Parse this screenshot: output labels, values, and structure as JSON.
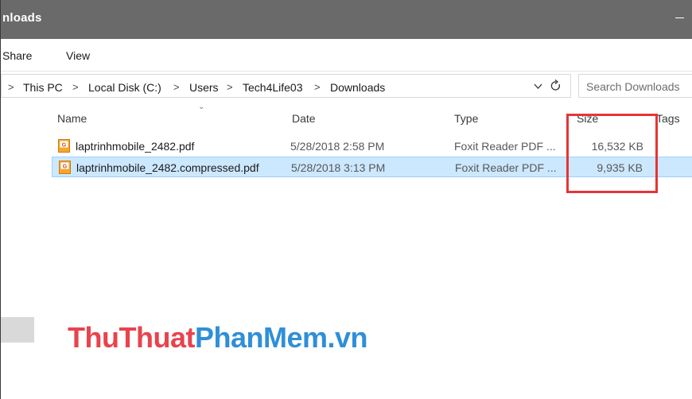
{
  "window": {
    "title": "nloads"
  },
  "ribbon": {
    "tabs": [
      "Share",
      "View"
    ]
  },
  "address": {
    "back_sep": ">",
    "crumbs": [
      "This PC",
      "Local Disk (C:)",
      "Users",
      "Tech4Life03",
      "Downloads"
    ],
    "sep": ">",
    "dropdown_icon": "chevron-down",
    "refresh_icon": "refresh"
  },
  "search": {
    "placeholder": "Search Downloads"
  },
  "columns": {
    "name": "Name",
    "date": "Date",
    "type": "Type",
    "size": "Size",
    "tags": "Tags",
    "sort_arrow": "⌄"
  },
  "files": [
    {
      "name": "laptrinhmobile_2482.pdf",
      "date": "5/28/2018 2:58 PM",
      "type": "Foxit Reader PDF ...",
      "size": "16,532 KB",
      "selected": false
    },
    {
      "name": "laptrinhmobile_2482.compressed.pdf",
      "date": "5/28/2018 3:13 PM",
      "type": "Foxit Reader PDF ...",
      "size": "9,935 KB",
      "selected": true
    }
  ],
  "annotation": {
    "color": "#e53535"
  },
  "watermark": {
    "part1": "ThuThuat",
    "part2": "PhanMem.vn"
  }
}
